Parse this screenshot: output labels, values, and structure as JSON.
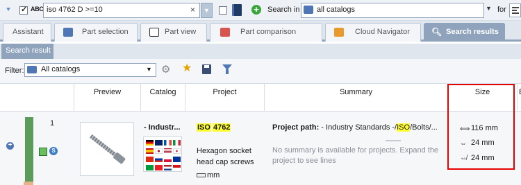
{
  "search": {
    "abc_label": "ABC",
    "query": "iso 4762 D >=10",
    "search_in_label": "Search in",
    "catalog_scope": "all catalogs",
    "for_label": "for"
  },
  "tabs": [
    {
      "label": "Assistant",
      "active": false
    },
    {
      "label": "Part selection",
      "active": false
    },
    {
      "label": "Part view",
      "active": false
    },
    {
      "label": "Part comparison",
      "active": false
    },
    {
      "label": "Cloud Navigator",
      "active": false
    },
    {
      "label": "Search results",
      "active": true
    }
  ],
  "subtab": {
    "label": "Search result"
  },
  "filter": {
    "label": "Filter:",
    "value": "All catalogs"
  },
  "columns": {
    "preview": "Preview",
    "catalog": "Catalog",
    "project": "Project",
    "summary": "Summary",
    "size": "Size",
    "extra": "E"
  },
  "row": {
    "number": "1",
    "catalog_name": "- Industr...",
    "project_iso": "ISO",
    "project_num": "4762",
    "project_title": "Hexagon socket head cap screws",
    "project_unit": "mm",
    "summary_path_label": "Project path:",
    "summary_path_pre": " - Industry Standards -/",
    "summary_path_hl": "ISO",
    "summary_path_post": "/Bolts/...",
    "summary_note": "No summary is available for projects. Expand the project to see lines",
    "sizes": [
      "116 mm",
      "24 mm",
      "24 mm"
    ]
  },
  "colors": {
    "accent": "#8fa3bd",
    "highlight": "#ffff33",
    "annotation_box": "#e60000",
    "status_green": "#5b9b5b"
  }
}
